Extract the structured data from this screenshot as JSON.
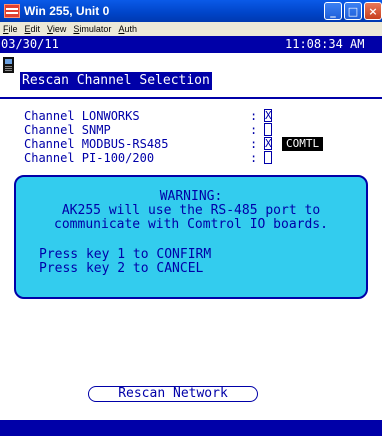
{
  "window": {
    "title": "Win 255, Unit 0",
    "buttons": {
      "minimize": "_",
      "maximize": "□",
      "close": "×"
    }
  },
  "menu": [
    {
      "label": "File",
      "accel": "F",
      "rest": "ile"
    },
    {
      "label": "Edit",
      "accel": "E",
      "rest": "dit"
    },
    {
      "label": "View",
      "accel": "V",
      "rest": "iew"
    },
    {
      "label": "Simulator",
      "accel": "S",
      "rest": "imulator"
    },
    {
      "label": "Auth",
      "accel": "A",
      "rest": "uth"
    }
  ],
  "status": {
    "date": "03/30/11",
    "time": "11:08:34 AM"
  },
  "screen": {
    "title": "Rescan Channel Selection"
  },
  "channels": [
    {
      "label": "Channel LONWORKS",
      "colon": ":",
      "checked": true,
      "check_mark": "X",
      "tag": ""
    },
    {
      "label": "Channel SNMP",
      "colon": ":",
      "checked": false,
      "check_mark": "",
      "tag": ""
    },
    {
      "label": "Channel MODBUS-RS485",
      "colon": ":",
      "checked": true,
      "check_mark": "X",
      "tag": "COMTL"
    },
    {
      "label": "Channel PI-100/200",
      "colon": ":",
      "checked": false,
      "check_mark": "",
      "tag": ""
    }
  ],
  "warning": {
    "heading": "WARNING:",
    "line1": "AK255 will use the RS-485 port to",
    "line2": "communicate with Comtrol IO boards.",
    "confirm": "Press key 1 to CONFIRM",
    "cancel": "Press key 2 to CANCEL"
  },
  "actions": {
    "rescan_label": "Rescan Network"
  },
  "colors": {
    "title_bar": "#0044c8",
    "terminal_blue": "#0000a8",
    "warning_bg": "#33ccee",
    "tag_bg": "#000000"
  }
}
